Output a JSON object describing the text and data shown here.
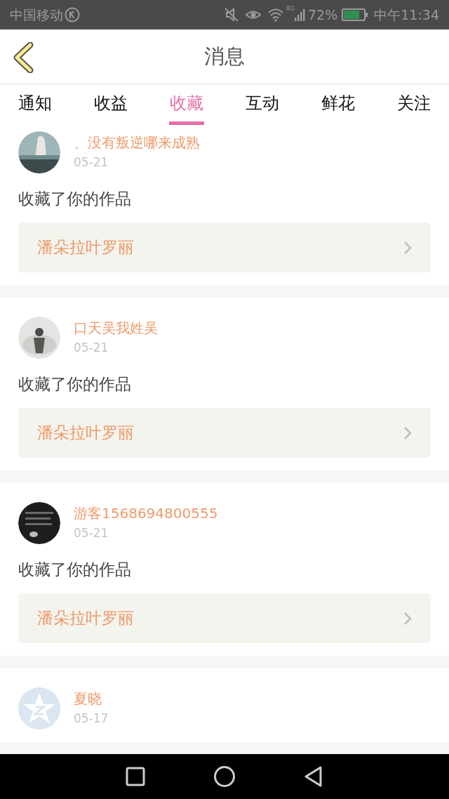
{
  "status_bar": {
    "carrier": "中国移动",
    "network": "4G",
    "battery": "72%",
    "time": "中午11:34"
  },
  "header": {
    "title": "消息"
  },
  "tabs": [
    {
      "label": "通知",
      "selected": false
    },
    {
      "label": "收益",
      "selected": false
    },
    {
      "label": "收藏",
      "selected": true
    },
    {
      "label": "互动",
      "selected": false
    },
    {
      "label": "鲜花",
      "selected": false
    },
    {
      "label": "关注",
      "selected": false
    }
  ],
  "messages": [
    {
      "user": "、没有叛逆哪来成熟",
      "date": "05-21",
      "text": "收藏了你的作品",
      "work": "潘朵拉叶罗丽"
    },
    {
      "user": "口天吴我姓吴",
      "date": "05-21",
      "text": "收藏了你的作品",
      "work": "潘朵拉叶罗丽"
    },
    {
      "user": "游客1568694800555",
      "date": "05-21",
      "text": "收藏了你的作品",
      "work": "潘朵拉叶罗丽"
    },
    {
      "user": "夏晓",
      "date": "05-17",
      "avatar": {
        "kind": "default"
      }
    }
  ]
}
